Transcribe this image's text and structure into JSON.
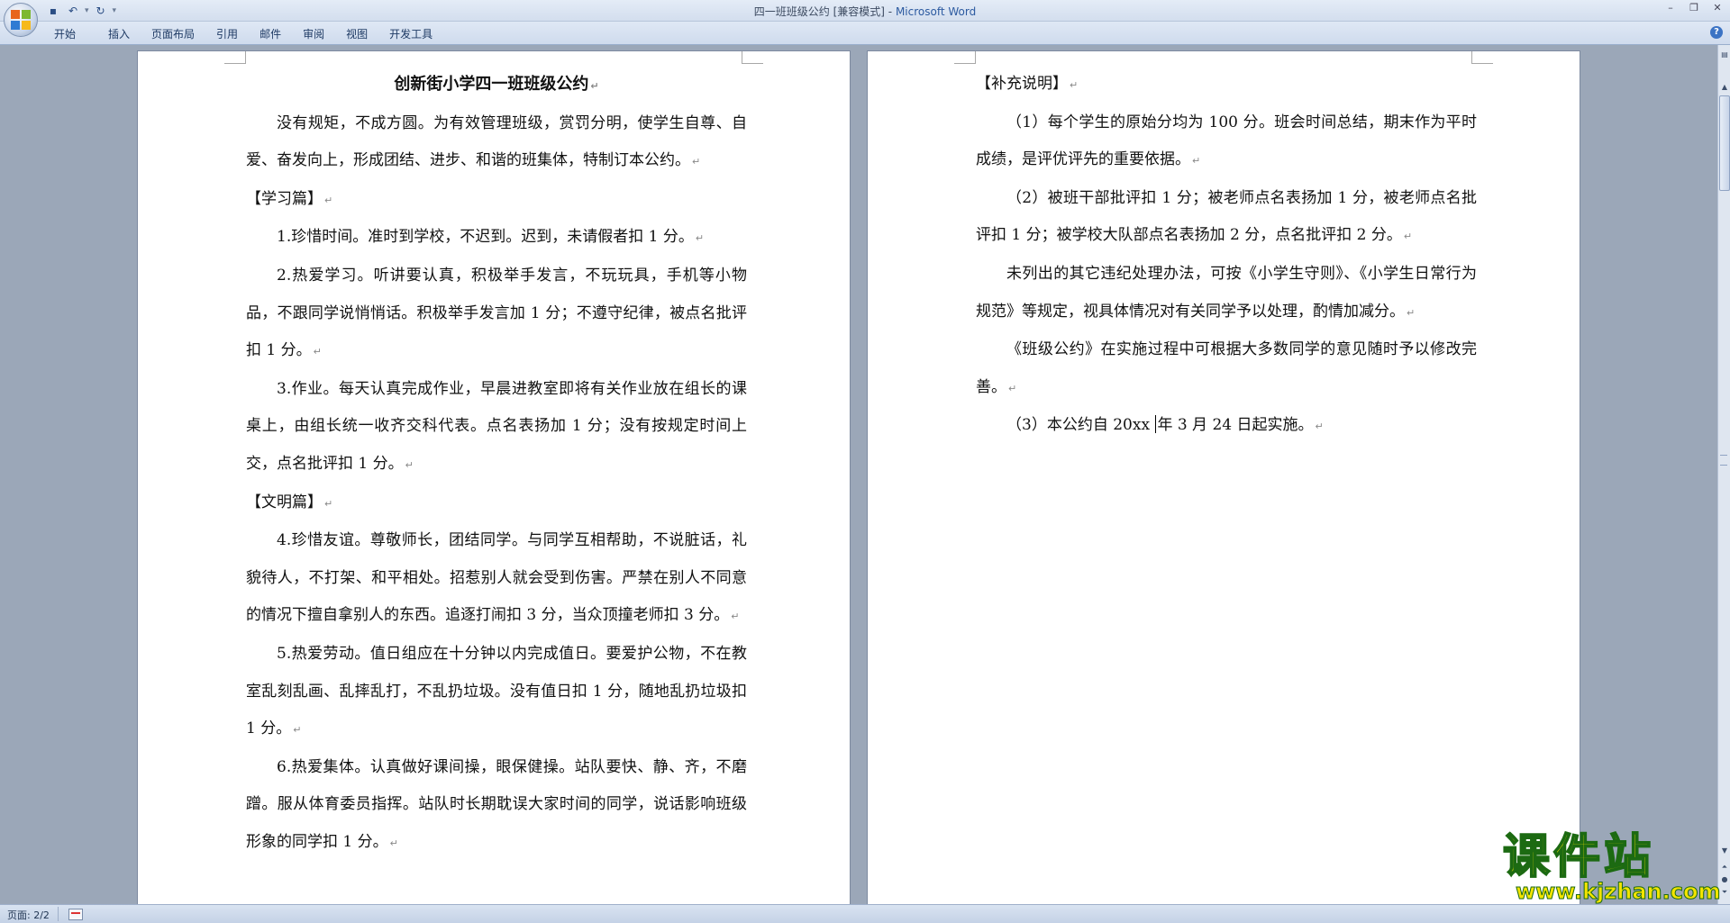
{
  "window": {
    "title": "四一班班级公约 [兼容模式]",
    "separator": " - ",
    "app": "Microsoft Word"
  },
  "qat": {
    "save_icon": "save-icon",
    "undo_icon": "undo-icon",
    "redo_icon": "redo-icon"
  },
  "ribbon": {
    "tabs": [
      "开始",
      "插入",
      "页面布局",
      "引用",
      "邮件",
      "审阅",
      "视图",
      "开发工具"
    ]
  },
  "page1": {
    "title": "创新街小学四一班班级公约",
    "paragraphs": [
      {
        "type": "para",
        "text": "没有规矩，不成方圆。为有效管理班级，赏罚分明，使学生自尊、自爱、奋发向上，形成团结、进步、和谐的班集体，特制订本公约。"
      },
      {
        "type": "heading",
        "text": "【学习篇】"
      },
      {
        "type": "para",
        "text": "1.珍惜时间。准时到学校，不迟到。迟到，未请假者扣 1 分。"
      },
      {
        "type": "para",
        "text": "2.热爱学习。听讲要认真，积极举手发言，不玩玩具，手机等小物品，不跟同学说悄悄话。积极举手发言加 1 分；不遵守纪律，被点名批评扣 1 分。"
      },
      {
        "type": "para",
        "text": "3.作业。每天认真完成作业，早晨进教室即将有关作业放在组长的课桌上，由组长统一收齐交科代表。点名表扬加 1 分；没有按规定时间上交，点名批评扣 1 分。"
      },
      {
        "type": "heading",
        "text": "【文明篇】"
      },
      {
        "type": "para",
        "text": "4.珍惜友谊。尊敬师长，团结同学。与同学互相帮助，不说脏话，礼貌待人，不打架、和平相处。招惹别人就会受到伤害。严禁在别人不同意的情况下擅自拿别人的东西。追逐打闹扣 3 分，当众顶撞老师扣 3 分。"
      },
      {
        "type": "para",
        "text": "5.热爱劳动。值日组应在十分钟以内完成值日。要爱护公物，不在教室乱刻乱画、乱摔乱打，不乱扔垃圾。没有值日扣 1 分，随地乱扔垃圾扣 1 分。"
      },
      {
        "type": "para",
        "text": "6.热爱集体。认真做好课间操，眼保健操。站队要快、静、齐，不磨蹭。服从体育委员指挥。站队时长期耽误大家时间的同学，说话影响班级形象的同学扣 1 分。"
      }
    ]
  },
  "page2": {
    "heading": "【补充说明】",
    "paragraphs": [
      "（1）每个学生的原始分均为 100 分。班会时间总结，期末作为平时成绩，是评优评先的重要依据。",
      "（2）被班干部批评扣 1 分；被老师点名表扬加 1 分，被老师点名批评扣 1 分；被学校大队部点名表扬加 2 分，点名批评扣 2 分。",
      "未列出的其它违纪处理办法，可按《小学生守则》、《小学生日常行为规范》等规定，视具体情况对有关同学予以处理，酌情加减分。",
      "《班级公约》在实施过程中可根据大多数同学的意见随时予以修改完善。"
    ],
    "last_before_cursor": "（3）本公约自 20xx ",
    "last_after_cursor": "年 3 月 24 日起实施。"
  },
  "paragraph_mark": "↵",
  "status": {
    "page": "页面: 2/2"
  },
  "watermark": {
    "text": "课件站",
    "url": "www.kjzhan.com"
  }
}
